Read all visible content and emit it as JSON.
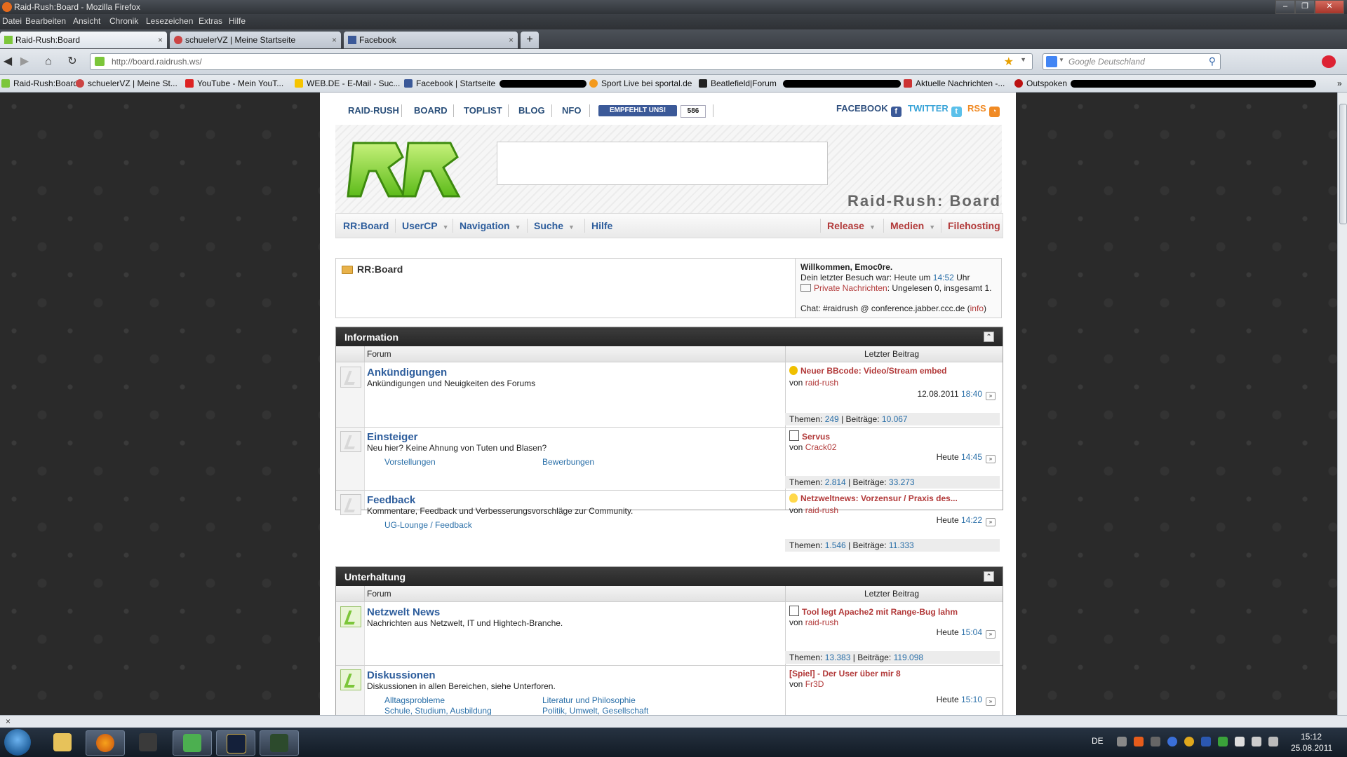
{
  "window": {
    "title": "Raid-Rush:Board - Mozilla Firefox"
  },
  "menu": [
    "Datei",
    "Bearbeiten",
    "Ansicht",
    "Chronik",
    "Lesezeichen",
    "Extras",
    "Hilfe"
  ],
  "tabs": [
    {
      "label": "Raid-Rush:Board",
      "close": "×"
    },
    {
      "label": "schuelerVZ | Meine Startseite",
      "close": "×"
    },
    {
      "label": "Facebook",
      "close": "×"
    }
  ],
  "newtab": "+",
  "url": "http://board.raidrush.ws/",
  "search": {
    "placeholder": "Google Deutschland"
  },
  "bookmarks": [
    "Raid-Rush:Board",
    "schuelerVZ | Meine St...",
    "YouTube - Mein YouT...",
    "WEB.DE - E-Mail - Suc...",
    "Facebook | Startseite",
    "Sport Live bei sportal.de",
    "Beatlefield|Forum",
    "Aktuelle Nachrichten -...",
    "Outspoken"
  ],
  "topnav": [
    "RAID-RUSH",
    "BOARD",
    "TOPLIST",
    "BLOG",
    "NFO"
  ],
  "fb": {
    "recommend": "EMPFEHLT UNS!",
    "count": "586"
  },
  "social": {
    "facebook": "FACEBOOK",
    "twitter": "TWITTER",
    "rss": "RSS"
  },
  "board_title": "Raid-Rush: Board",
  "mainnav_left": [
    {
      "label": "RR:Board",
      "dd": ""
    },
    {
      "label": "UserCP",
      "dd": "▼"
    },
    {
      "label": "Navigation",
      "dd": "▼"
    },
    {
      "label": "Suche",
      "dd": "▼"
    },
    {
      "label": "Hilfe",
      "dd": ""
    }
  ],
  "mainnav_right": [
    {
      "label": "Release",
      "dd": "▼"
    },
    {
      "label": "Medien",
      "dd": "▼"
    },
    {
      "label": "Filehosting",
      "dd": ""
    }
  ],
  "breadcrumb": "RR:Board",
  "welcome": {
    "line1": "Willkommen, Emoc0re.",
    "last_visit_pre": "Dein letzter Besuch war: Heute um",
    "last_visit_time": "14:52",
    "last_visit_post": "Uhr",
    "pm_link": "Private Nachrichten",
    "pm_text": ": Ungelesen 0, insgesamt 1.",
    "chat_pre": "Chat: #raidrush @ conference.jabber.ccc.de (",
    "chat_link": "info",
    "chat_post": ")"
  },
  "col_forum": "Forum",
  "col_last": "Letzter Beitrag",
  "von": "von",
  "themen": "Themen:",
  "beitraege": "Beiträge:",
  "categories": [
    {
      "title": "Information",
      "collapse": "⌃",
      "forums": [
        {
          "title": "Ankündigungen",
          "desc": "Ankündigungen und Neuigkeiten des Forums",
          "subs": [],
          "last_title": "Neuer BBcode: Video/Stream embed",
          "last_by": "raid-rush",
          "date": "12.08.2011",
          "time": "18:40",
          "themen": "249",
          "beitraege": "10.067"
        },
        {
          "title": "Einsteiger",
          "desc": "Neu hier? Keine Ahnung von Tuten und Blasen?",
          "subs": [
            "Vorstellungen",
            "Bewerbungen"
          ],
          "last_title": "Servus",
          "last_by": "Crack02",
          "date": "Heute",
          "time": "14:45",
          "themen": "2.814",
          "beitraege": "33.273"
        },
        {
          "title": "Feedback",
          "desc": "Kommentare, Feedback und Verbesserungsvorschläge zur Community.",
          "subs": [
            "UG-Lounge / Feedback"
          ],
          "last_title": "Netzweltnews: Vorzensur / Praxis des...",
          "last_by": "raid-rush",
          "date": "Heute",
          "time": "14:22",
          "themen": "1.546",
          "beitraege": "11.333"
        }
      ]
    },
    {
      "title": "Unterhaltung",
      "collapse": "⌃",
      "forums": [
        {
          "title": "Netzwelt News",
          "desc": "Nachrichten aus Netzwelt, IT und Hightech-Branche.",
          "subs": [],
          "last_title": "Tool legt Apache2 mit Range-Bug lahm",
          "last_by": "raid-rush",
          "date": "Heute",
          "time": "15:04",
          "themen": "13.383",
          "beitraege": "119.098"
        },
        {
          "title": "Diskussionen",
          "desc": "Diskussionen in allen Bereichen, siehe Unterforen.",
          "subs": [
            "Alltagsprobleme",
            "Literatur und Philosophie",
            "Schule, Studium, Ausbildung",
            "Politik, Umwelt, Gesellschaft"
          ],
          "last_title": "[Spiel] - Der User über mir 8",
          "last_by": "Fr3D",
          "date": "Heute",
          "time": "15:10",
          "themen": "",
          "beitraege": ""
        }
      ]
    }
  ],
  "go": "»",
  "status": "×",
  "tray": {
    "lang": "DE",
    "time": "15:12",
    "date": "25.08.2011"
  },
  "colors": {
    "link_blue": "#2d5d9c",
    "accent_red": "#b23a3a",
    "cat_header": "#2e2e2e"
  }
}
